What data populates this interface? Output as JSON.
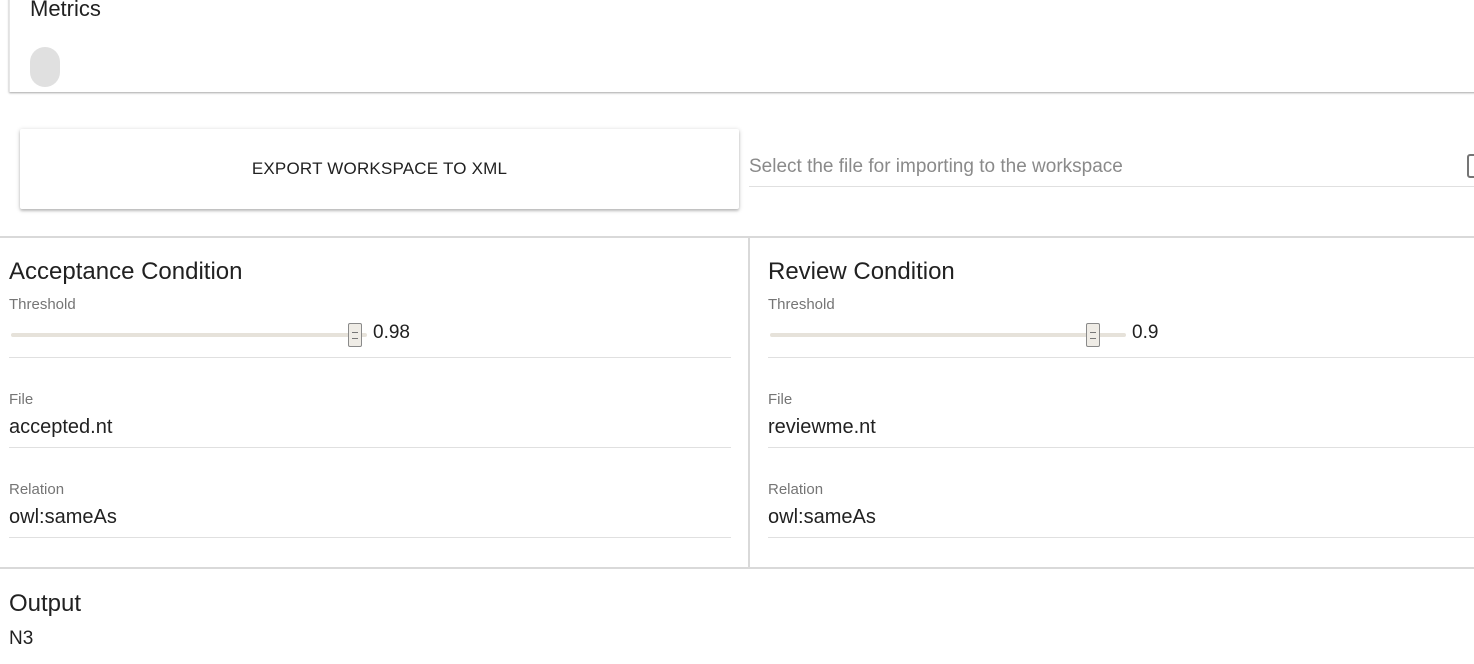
{
  "metrics": {
    "title": "Metrics"
  },
  "export": {
    "button_label": "EXPORT WORKSPACE TO XML"
  },
  "import": {
    "placeholder": "Select the file for importing to the workspace"
  },
  "acceptance": {
    "title": "Acceptance Condition",
    "threshold_label": "Threshold",
    "threshold_value": "0.98",
    "threshold_fraction": 0.98,
    "file_label": "File",
    "file_value": "accepted.nt",
    "relation_label": "Relation",
    "relation_value": "owl:sameAs"
  },
  "review": {
    "title": "Review Condition",
    "threshold_label": "Threshold",
    "threshold_value": "0.9",
    "threshold_fraction": 0.9,
    "file_label": "File",
    "file_value": "reviewme.nt",
    "relation_label": "Relation",
    "relation_value": "owl:sameAs"
  },
  "output": {
    "title": "Output",
    "value": "N3"
  }
}
